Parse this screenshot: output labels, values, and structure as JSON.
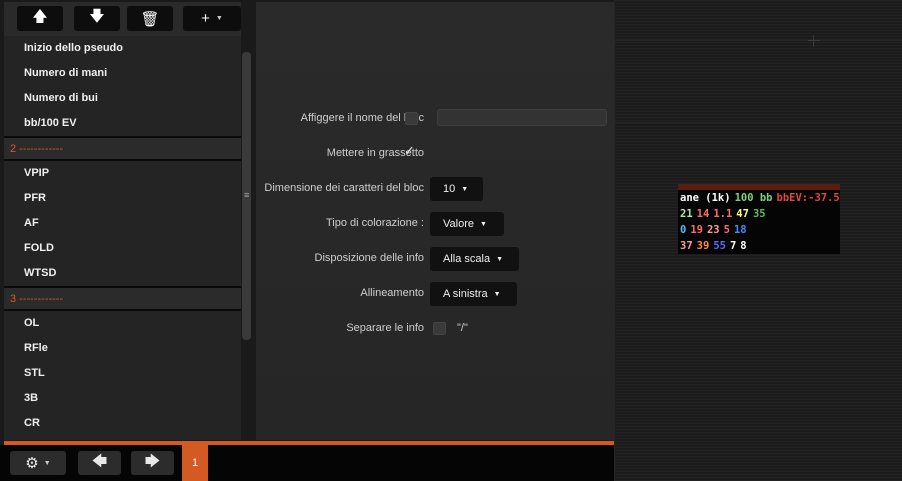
{
  "toolbar": {
    "move_up_icon": "arrow-up-icon",
    "move_down_icon": "arrow-down-icon",
    "delete_icon": "trash-icon",
    "add_icon": "plus-icon",
    "up_glyph": "🡅",
    "down_glyph": "🡇",
    "trash_glyph": "🗑",
    "plus_glyph": "+",
    "caret": "▼"
  },
  "stats": [
    {
      "type": "item",
      "label": "Inizio dello pseudo"
    },
    {
      "type": "item",
      "label": "Numero di mani"
    },
    {
      "type": "item",
      "label": "Numero di bui"
    },
    {
      "type": "item",
      "label": "bb/100 EV"
    },
    {
      "type": "sep",
      "label": "2 ------------"
    },
    {
      "type": "item",
      "label": "VPIP"
    },
    {
      "type": "item",
      "label": "PFR"
    },
    {
      "type": "item",
      "label": "AF"
    },
    {
      "type": "item",
      "label": "FOLD"
    },
    {
      "type": "item",
      "label": "WTSD"
    },
    {
      "type": "sep",
      "label": "3 ------------"
    },
    {
      "type": "item",
      "label": "OL"
    },
    {
      "type": "item",
      "label": "RFle"
    },
    {
      "type": "item",
      "label": "STL"
    },
    {
      "type": "item",
      "label": "3B"
    },
    {
      "type": "item",
      "label": "CR"
    }
  ],
  "settings": {
    "show_block_name": {
      "label": "Affiggere il nome del bloc",
      "checked": false,
      "value": ""
    },
    "bold": {
      "label": "Mettere in grassetto",
      "checked": true,
      "checkmark": "✓"
    },
    "font_size": {
      "label": "Dimensione dei caratteri del bloc",
      "value": "10"
    },
    "coloring": {
      "label": "Tipo di colorazione :",
      "value": "Valore"
    },
    "layout": {
      "label": "Disposizione delle info",
      "value": "Alla scala"
    },
    "alignment": {
      "label": "Allineamento",
      "value": "A sinistra"
    },
    "separator": {
      "label": "Separare le info",
      "checked": false,
      "value": "\"/\""
    },
    "caret": "▼"
  },
  "splitter_glyph": "≡",
  "hud": {
    "rows": [
      [
        {
          "text": "ane (1k)",
          "color": "#ffffff"
        },
        {
          "text": "100 bb",
          "color": "#7fd07f"
        },
        {
          "text": "bbEV:-37.5",
          "color": "#e04545"
        }
      ],
      [
        {
          "text": "21",
          "color": "#9ef59e"
        },
        {
          "text": "14",
          "color": "#ff6b6b"
        },
        {
          "text": "1.1",
          "color": "#ff6b6b"
        },
        {
          "text": "47",
          "color": "#ffff66"
        },
        {
          "text": "35",
          "color": "#5bbf5b"
        }
      ],
      [
        {
          "text": "0",
          "color": "#5ab8ff"
        },
        {
          "text": "19",
          "color": "#ff6b6b"
        },
        {
          "text": "23",
          "color": "#ff9a9a"
        },
        {
          "text": "5",
          "color": "#ff6b6b"
        },
        {
          "text": "18",
          "color": "#3f8cff"
        }
      ],
      [
        {
          "text": "37",
          "color": "#ff9a9a"
        },
        {
          "text": "39",
          "color": "#ff8a3a"
        },
        {
          "text": "55",
          "color": "#5a6bff"
        },
        {
          "text": "7",
          "color": "#ffffff"
        },
        {
          "text": "8",
          "color": "#ffffff"
        }
      ]
    ]
  },
  "bottom": {
    "settings_glyph": "⚙",
    "prev_glyph": "🡄",
    "next_glyph": "🡆",
    "caret": "▼",
    "page": "1"
  },
  "colors": {
    "accent": "#d35a22"
  }
}
